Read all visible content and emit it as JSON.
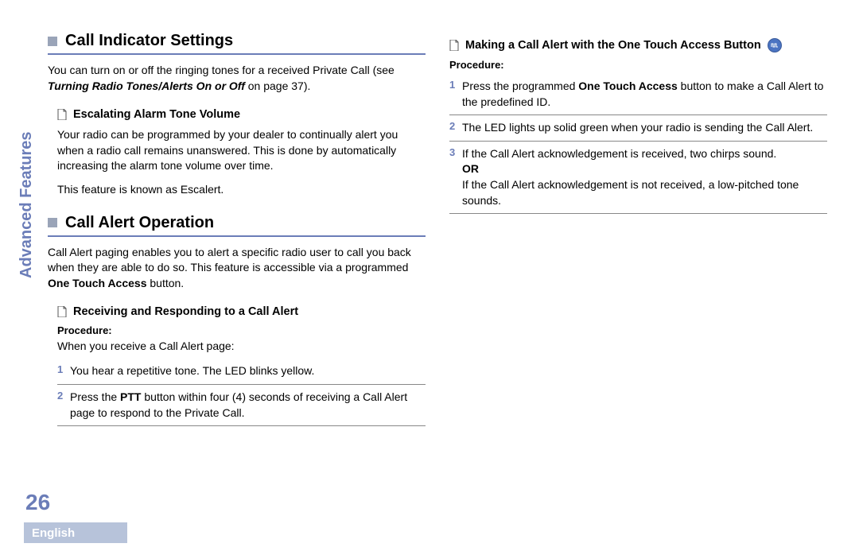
{
  "sidebar": {
    "label": "Advanced Features"
  },
  "pageNumber": "26",
  "footer": {
    "language": "English"
  },
  "left": {
    "section1": {
      "title": "Call Indicator Settings",
      "intro_prefix": "You can turn on or off the ringing tones for a received Private Call (see ",
      "intro_ref": "Turning Radio Tones/Alerts On or Off",
      "intro_suffix": " on page 37).",
      "sub1": {
        "title": "Escalating Alarm Tone Volume",
        "p1": "Your radio can be programmed by your dealer to continually alert you when a radio call remains unanswered. This is done by automatically increasing the alarm tone volume over time.",
        "p2": "This feature is known as Escalert."
      }
    },
    "section2": {
      "title": "Call Alert Operation",
      "intro_prefix": "Call Alert paging enables you to alert a specific radio user to call you back when they are able to do so. This feature is accessible via a programmed ",
      "intro_bold": "One Touch Access",
      "intro_suffix": " button.",
      "sub1": {
        "title": "Receiving and Responding to a Call Alert",
        "procedureLabel": "Procedure:",
        "procedureIntro": "When you receive a Call Alert page:",
        "steps": [
          {
            "n": "1",
            "text": "You hear a repetitive tone. The LED blinks yellow."
          },
          {
            "n": "2",
            "text_prefix": "Press the ",
            "text_bold": "PTT",
            "text_suffix": " button within four (4) seconds of receiving a Call Alert page to respond to the Private Call."
          }
        ]
      }
    }
  },
  "right": {
    "sub1": {
      "title": "Making a Call Alert with the One Touch Access Button",
      "procedureLabel": "Procedure:",
      "steps": [
        {
          "n": "1",
          "text_prefix": "Press the programmed ",
          "text_bold": "One Touch Access",
          "text_suffix": " button to make a Call Alert to the predefined ID."
        },
        {
          "n": "2",
          "text": "The LED lights up solid green when your radio is sending the Call Alert."
        },
        {
          "n": "3",
          "text_a": "If the Call Alert acknowledgement is received, two chirps sound.",
          "text_or": "OR",
          "text_b": "If the Call Alert acknowledgement is not received, a low-pitched tone sounds."
        }
      ]
    }
  }
}
